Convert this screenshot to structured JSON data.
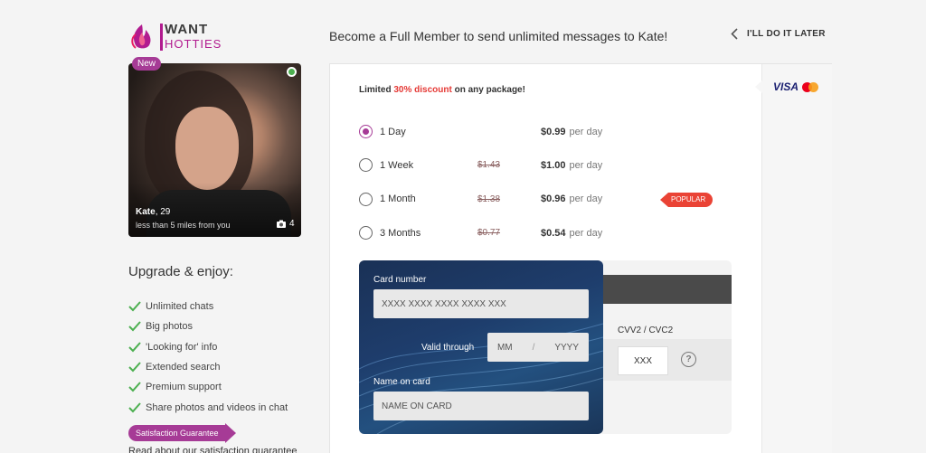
{
  "logo": {
    "line1": "WANT",
    "line2": "HOTTIES"
  },
  "profile": {
    "badge": "New",
    "name": "Kate",
    "age": ", 29",
    "distance": "less than 5 miles from you",
    "photo_count": "4"
  },
  "upgrade": {
    "title": "Upgrade & enjoy:",
    "features": [
      "Unlimited chats",
      "Big photos",
      "'Looking for' info",
      "Extended search",
      "Premium support",
      "Share photos and videos in chat"
    ],
    "guarantee_badge": "Satisfaction Guarantee",
    "guarantee_text": "Read about our satisfaction guarantee"
  },
  "header": {
    "headline": "Become a Full Member to send unlimited messages to Kate!",
    "later": "I'LL DO IT LATER"
  },
  "payment": {
    "card_brand": "VISA",
    "promo_prefix": "Limited ",
    "promo_discount": "30% discount",
    "promo_suffix": " on any package!",
    "plans": [
      {
        "label": "1 Day",
        "old_price": "",
        "price": "$0.99",
        "per": "per day",
        "selected": true
      },
      {
        "label": "1 Week",
        "old_price": "$1.43",
        "price": "$1.00",
        "per": "per day",
        "selected": false
      },
      {
        "label": "1 Month",
        "old_price": "$1.38",
        "price": "$0.96",
        "per": "per day",
        "selected": false
      },
      {
        "label": "3 Months",
        "old_price": "$0.77",
        "price": "$0.54",
        "per": "per day",
        "selected": false
      }
    ],
    "popular_label": "POPULAR"
  },
  "card_form": {
    "card_number_label": "Card number",
    "card_number_placeholder": "XXXX XXXX XXXX XXXX XXX",
    "valid_through_label": "Valid through",
    "month_placeholder": "MM",
    "separator": "/",
    "year_placeholder": "YYYY",
    "name_label": "Name on card",
    "name_placeholder": "NAME ON CARD",
    "cvv_label": "CVV2 / CVC2",
    "cvv_placeholder": "XXX",
    "help": "?"
  },
  "colors": {
    "brand": "#a63b96",
    "accent_red": "#ea4335",
    "online": "#4caf50",
    "check": "#4caf50"
  }
}
